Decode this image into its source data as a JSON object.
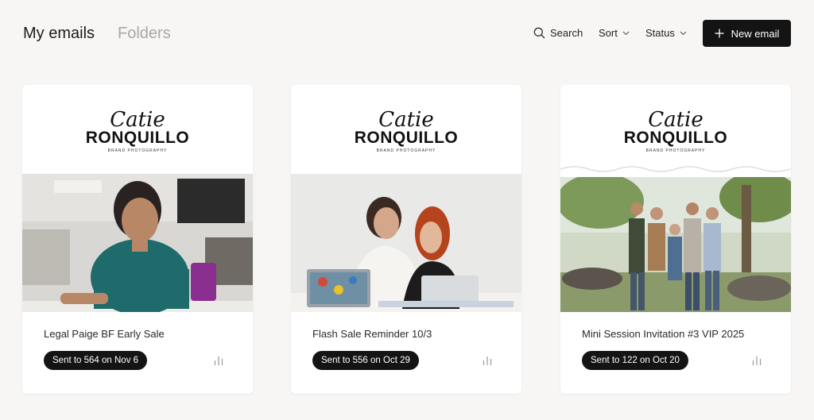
{
  "header": {
    "tabs": [
      {
        "label": "My emails",
        "active": true
      },
      {
        "label": "Folders",
        "active": false
      }
    ],
    "search_label": "Search",
    "sort_label": "Sort",
    "status_label": "Status",
    "new_email_label": "New email"
  },
  "icons": {
    "search": "search-icon",
    "chevron": "chevron-down-icon",
    "plus": "plus-icon",
    "stats": "bar-chart-icon"
  },
  "colors": {
    "background": "#f7f6f5",
    "primary_button": "#141414",
    "inactive_tab": "#a8a8a8"
  },
  "logo": {
    "script": "Catie",
    "main": "RONQUILLO",
    "sub": "BRAND PHOTOGRAPHY"
  },
  "cards": [
    {
      "title": "Legal Paige BF Early Sale",
      "sent": "Sent to 564 on Nov 6"
    },
    {
      "title": "Flash Sale Reminder 10/3",
      "sent": "Sent to 556 on Oct 29"
    },
    {
      "title": "Mini Session Invitation #3 VIP 2025",
      "sent": "Sent to 122 on Oct 20"
    }
  ]
}
